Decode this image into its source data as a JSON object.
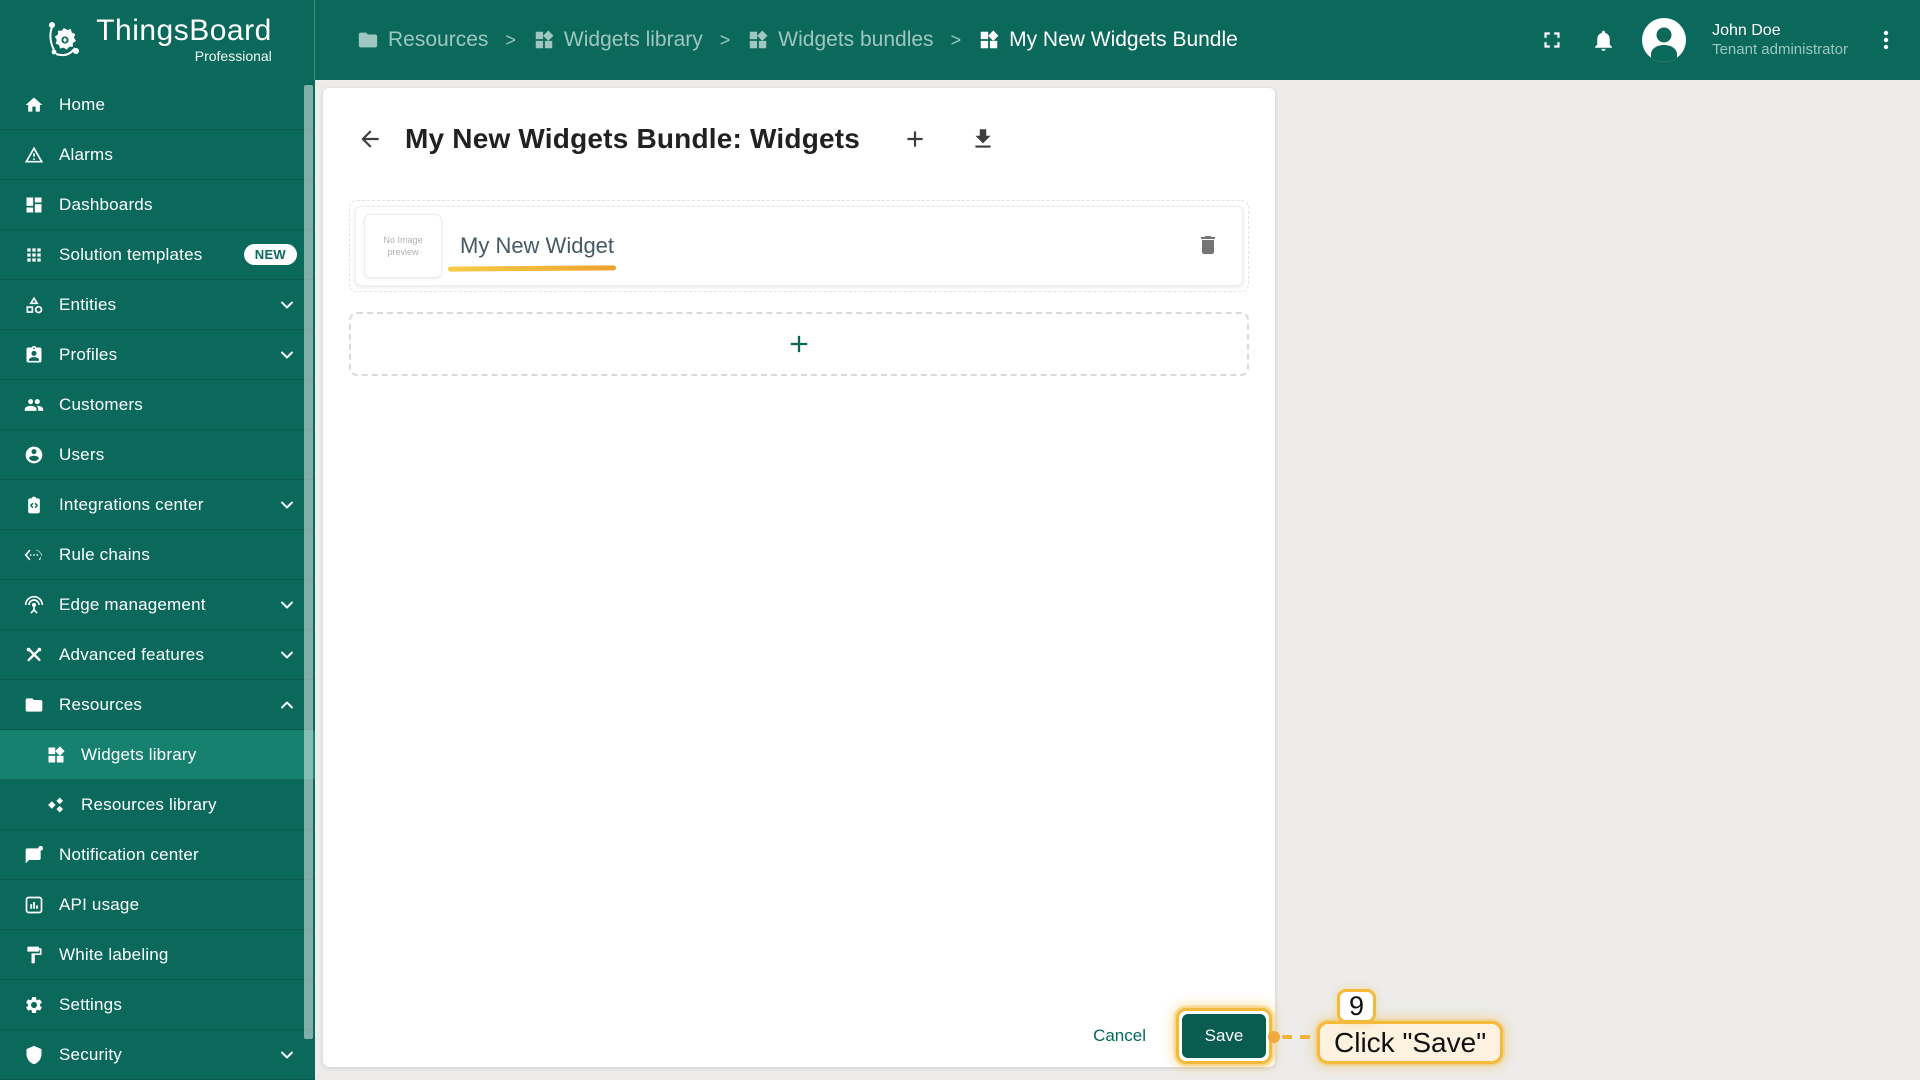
{
  "header": {
    "logo": {
      "title": "ThingsBoard",
      "subtitle": "Professional"
    },
    "breadcrumbs": [
      {
        "label": "Resources",
        "icon": "folder-icon"
      },
      {
        "label": "Widgets library",
        "icon": "widgets-icon"
      },
      {
        "label": "Widgets bundles",
        "icon": "widgets-icon"
      },
      {
        "label": "My New Widgets Bundle",
        "icon": "widgets-icon"
      }
    ],
    "breadcrumb_separator": ">",
    "user": {
      "name": "John Doe",
      "role": "Tenant administrator"
    }
  },
  "sidebar": {
    "items": [
      {
        "label": "Home"
      },
      {
        "label": "Alarms"
      },
      {
        "label": "Dashboards"
      },
      {
        "label": "Solution templates",
        "badge": "NEW"
      },
      {
        "label": "Entities",
        "expandable": true
      },
      {
        "label": "Profiles",
        "expandable": true
      },
      {
        "label": "Customers"
      },
      {
        "label": "Users"
      },
      {
        "label": "Integrations center",
        "expandable": true
      },
      {
        "label": "Rule chains"
      },
      {
        "label": "Edge management",
        "expandable": true
      },
      {
        "label": "Advanced features",
        "expandable": true
      },
      {
        "label": "Resources",
        "expandable": true,
        "expanded": true
      },
      {
        "label": "Widgets library",
        "child": true,
        "active": true
      },
      {
        "label": "Resources library",
        "child": true
      },
      {
        "label": "Notification center"
      },
      {
        "label": "API usage"
      },
      {
        "label": "White labeling"
      },
      {
        "label": "Settings"
      },
      {
        "label": "Security",
        "expandable": true
      }
    ]
  },
  "main": {
    "title": "My New Widgets Bundle: Widgets",
    "widgets": [
      {
        "name": "My New Widget",
        "thumbnail": {
          "line1": "No Image",
          "line2": "preview"
        }
      }
    ],
    "actions": {
      "cancel": "Cancel",
      "save": "Save"
    }
  },
  "annotation": {
    "step": "9",
    "text": "Click \"Save\""
  },
  "colors": {
    "primary": "#0b695c",
    "primary_active": "#17816f",
    "accent": "#00695c",
    "save_button": "#0b5c50",
    "annotation_gold": "#f4ba3a",
    "annotation_bg": "#fcf2df"
  }
}
